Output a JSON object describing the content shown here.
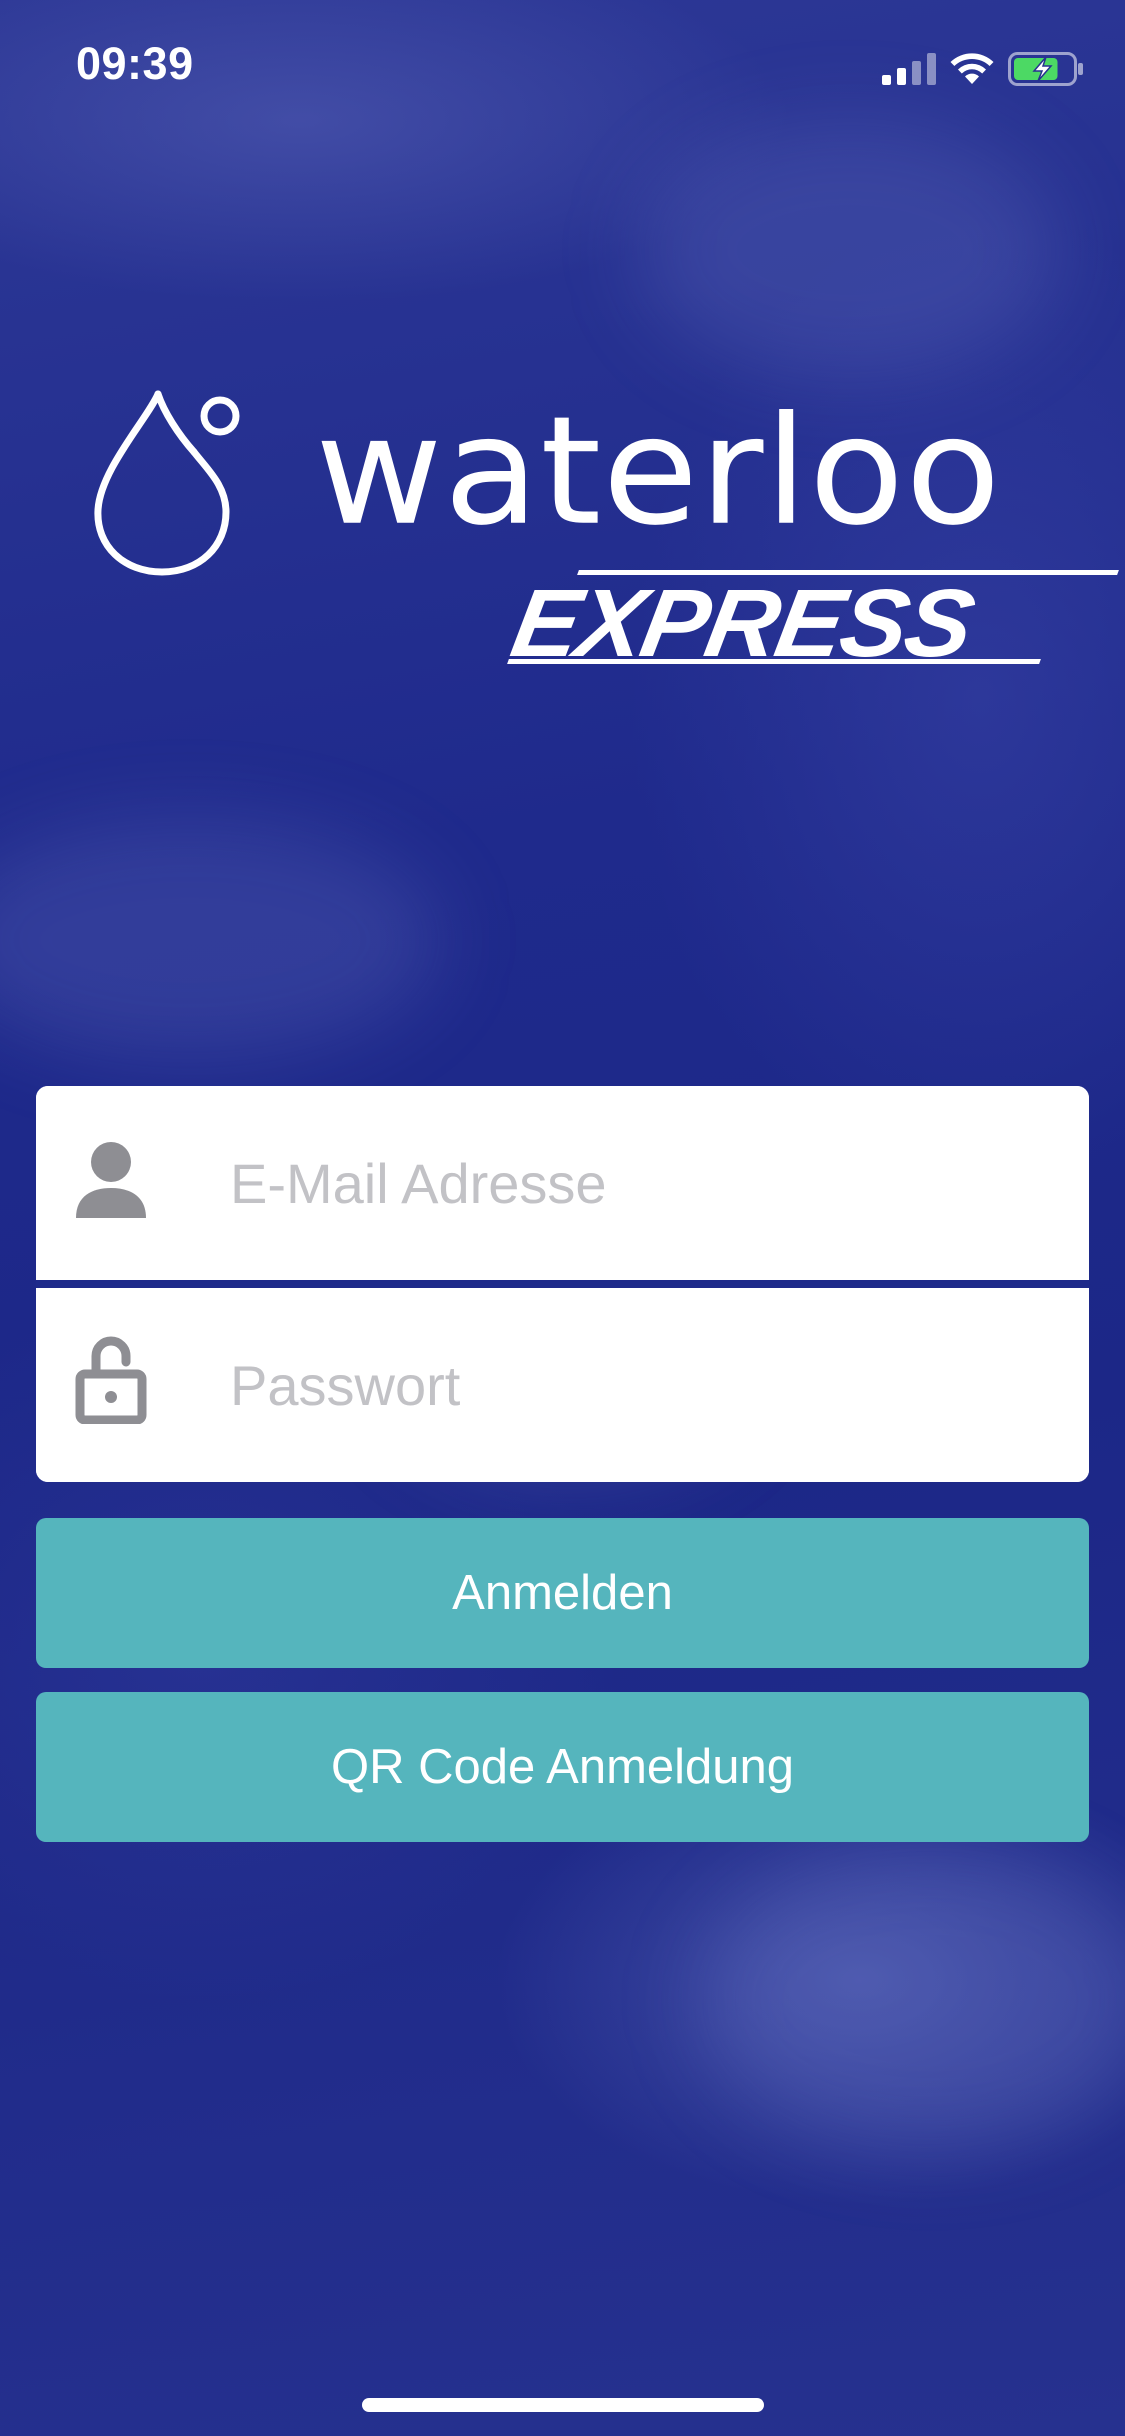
{
  "status_bar": {
    "time": "09:39",
    "signal_icon": "cellular-signal-icon",
    "wifi_icon": "wifi-icon",
    "battery_icon": "battery-charging-icon",
    "battery_level": 0.75
  },
  "brand": {
    "logo_icon": "water-drop-icon",
    "name": "waterloo",
    "tagline": "EXPRESS"
  },
  "login_form": {
    "email": {
      "icon": "user-icon",
      "placeholder": "E-Mail Adresse",
      "value": ""
    },
    "password": {
      "icon": "lock-icon",
      "placeholder": "Passwort",
      "value": ""
    }
  },
  "actions": {
    "login_label": "Anmelden",
    "qr_login_label": "QR Code Anmeldung"
  },
  "colors": {
    "background": "#1f2a8c",
    "divider": "#1e2a8a",
    "button": "#55b5bd",
    "battery_fill": "#4cd964"
  }
}
